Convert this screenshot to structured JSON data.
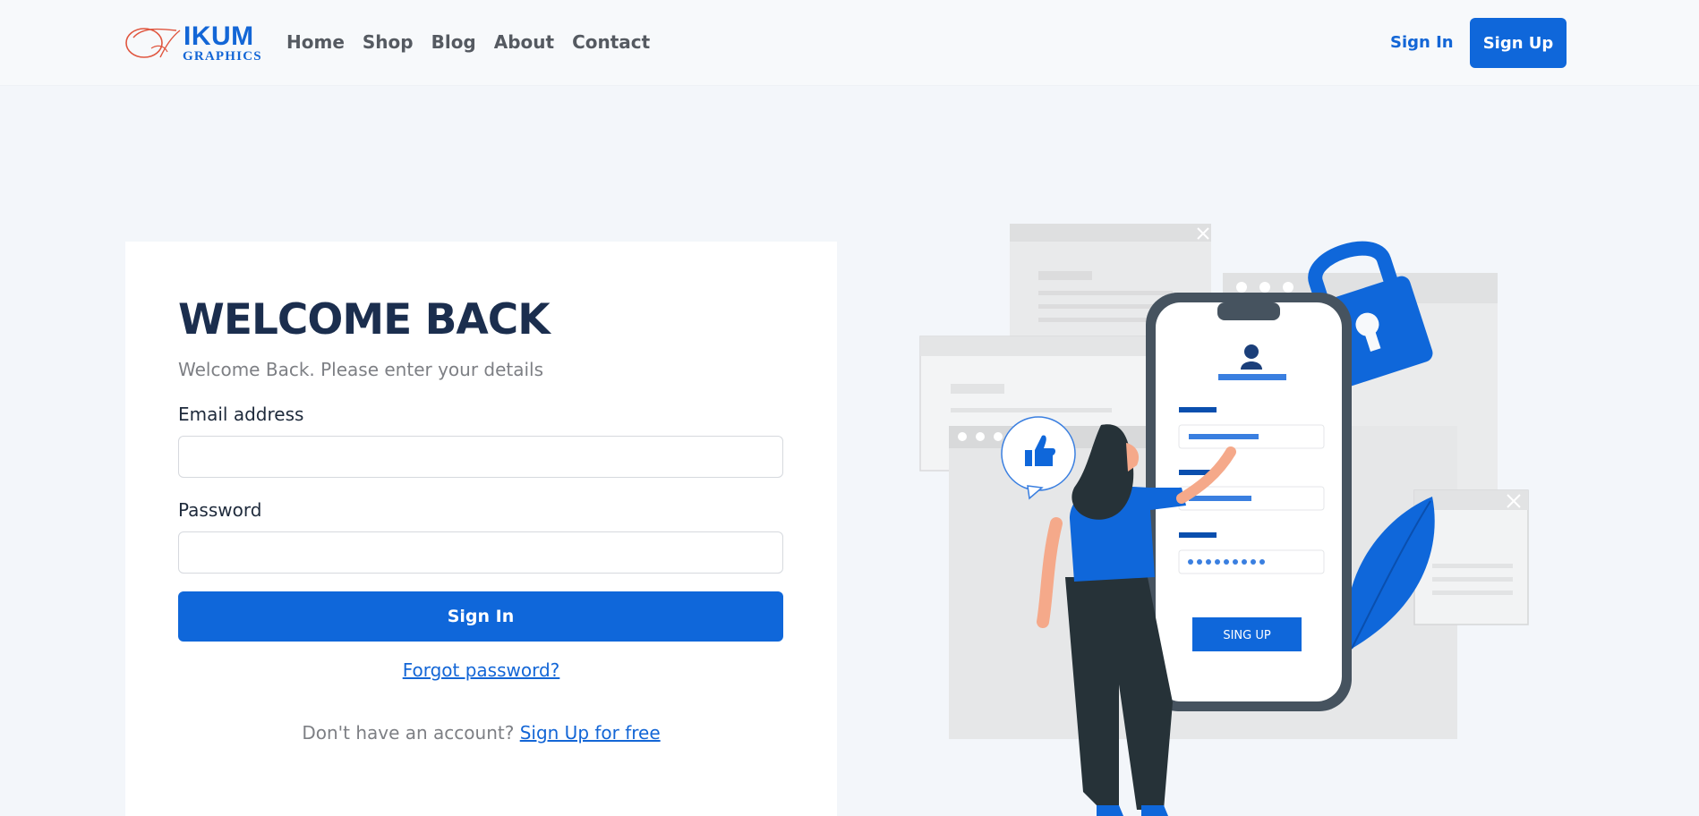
{
  "brand": {
    "name": "IKUM",
    "sub": "GRAPHICS",
    "primary_color": "#0f67da",
    "heading_color": "#1b2e4e"
  },
  "nav": {
    "links": [
      "Home",
      "Shop",
      "Blog",
      "About",
      "Contact"
    ],
    "sign_in": "Sign In",
    "sign_up": "Sign Up"
  },
  "login": {
    "title": "WELCOME BACK",
    "subtitle": "Welcome Back. Please enter your details",
    "email_label": "Email address",
    "email_value": "",
    "password_label": "Password",
    "password_value": "",
    "submit_label": "Sign In",
    "forgot_label": "Forgot password?",
    "no_account_text": "Don't have an account?",
    "signup_link": "Sign Up for free"
  },
  "illustration": {
    "phone_button_label": "SING UP",
    "icons": [
      "user-icon",
      "lock-icon",
      "thumbs-up-icon",
      "leaf-icon",
      "close-icon"
    ]
  }
}
